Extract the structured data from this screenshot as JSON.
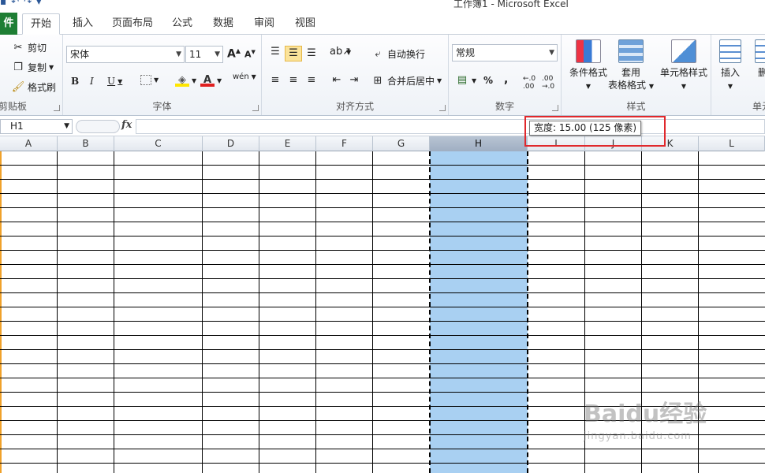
{
  "window": {
    "title": "工作簿1 - Microsoft Excel"
  },
  "tabs": [
    {
      "label": "件"
    },
    {
      "label": "开始"
    },
    {
      "label": "插入"
    },
    {
      "label": "页面布局"
    },
    {
      "label": "公式"
    },
    {
      "label": "数据"
    },
    {
      "label": "审阅"
    },
    {
      "label": "视图"
    }
  ],
  "ribbon": {
    "clipboard": {
      "label": "剪贴板",
      "cut": "剪切",
      "copy": "复制",
      "format_painter": "格式刷"
    },
    "font": {
      "label": "字体",
      "font_name": "宋体",
      "font_size": "11",
      "bold": "B",
      "italic": "I",
      "underline": "U",
      "font_color_glyph": "A",
      "phonetic_glyph": "wén"
    },
    "alignment": {
      "label": "对齐方式",
      "wrap_text": "自动换行",
      "merge_center": "合并后居中"
    },
    "number": {
      "label": "数字",
      "format": "常规",
      "percent": "%",
      "comma": ","
    },
    "styles": {
      "label": "样式",
      "conditional_formatting": "条件格式",
      "format_as_table_line1": "套用",
      "format_as_table_line2": "表格格式",
      "cell_styles": "单元格样式"
    },
    "cells": {
      "label": "单元",
      "insert": "插入",
      "delete": "删"
    }
  },
  "formula_bar": {
    "name_box": "H1",
    "fx": "fx",
    "value": ""
  },
  "tooltip": {
    "text": "宽度: 15.00 (125 像素)"
  },
  "columns": [
    "A",
    "B",
    "C",
    "D",
    "E",
    "F",
    "G",
    "H",
    "I",
    "J",
    "K",
    "L"
  ],
  "selected_column": "H",
  "watermark": {
    "brand": "Baidu经验",
    "url": "jingyan.baidu.com"
  },
  "colors": {
    "selection_fill": "#a9d0f2",
    "highlight_box": "#e0282c",
    "file_tab": "#1e7e34"
  }
}
